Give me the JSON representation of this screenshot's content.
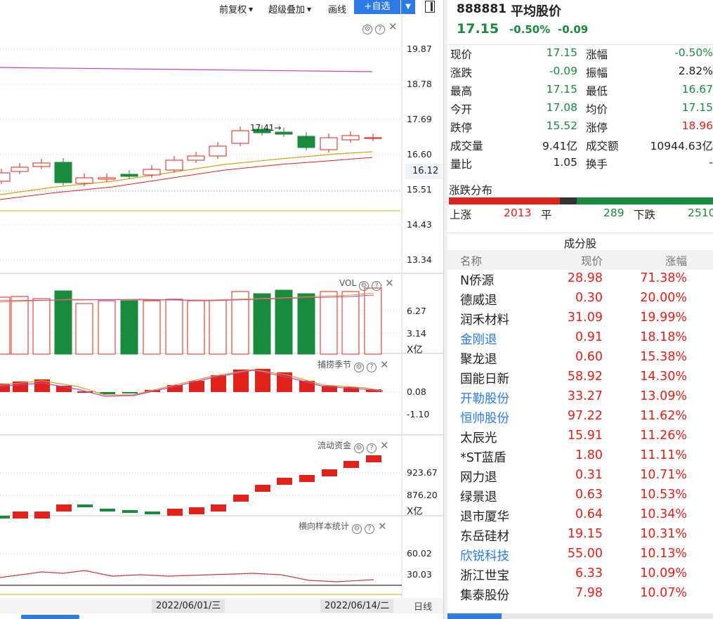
{
  "toolbar": {
    "rights_label": "前复权",
    "overlay_label": "超级叠加",
    "draw_label": "画线",
    "add_fav_label": "+自选",
    "dropdown_glyph": "▼"
  },
  "main_chart": {
    "y_ticks": [
      "19.87",
      "18.78",
      "17.69",
      "16.60",
      "15.51",
      "14.43",
      "13.34"
    ],
    "current_price": "16.12",
    "high_annotation": "17.41→",
    "colors": {
      "up": "#e0221b",
      "down": "#1a8a3c",
      "ma1": "#d4a017",
      "ma2": "#e0221b",
      "ma3": "#c040c0"
    }
  },
  "vol_pane": {
    "title": "VOL",
    "y_ticks": [
      "6.27",
      "3.14"
    ],
    "unit": "X亿"
  },
  "cycle_pane": {
    "title": "捕捞季节",
    "y_ticks": [
      "0.08",
      "-1.10"
    ]
  },
  "flow_pane": {
    "title": "流动资金",
    "y_ticks": [
      "923.67",
      "876.20"
    ],
    "unit": "X亿"
  },
  "stat_pane": {
    "title": "横向样本统计",
    "y_ticks": [
      "60.02",
      "30.03"
    ]
  },
  "datebar": {
    "date1": "2022/06/01/三",
    "date2": "2022/06/14/二",
    "period": "日线"
  },
  "quote": {
    "code": "888881",
    "name": "平均股价",
    "price": "17.15",
    "pct": "-0.50%",
    "change": "-0.09",
    "rows": [
      {
        "l1": "现价",
        "v1": "17.15",
        "c1": "green",
        "l2": "涨幅",
        "v2": "-0.50%",
        "c2": "green"
      },
      {
        "l1": "涨跌",
        "v1": "-0.09",
        "c1": "green",
        "l2": "振幅",
        "v2": "2.82%",
        "c2": "dark"
      },
      {
        "l1": "最高",
        "v1": "17.15",
        "c1": "green",
        "l2": "最低",
        "v2": "16.67",
        "c2": "green"
      },
      {
        "l1": "今开",
        "v1": "17.08",
        "c1": "green",
        "l2": "均价",
        "v2": "17.15",
        "c2": "green"
      },
      {
        "l1": "跌停",
        "v1": "15.52",
        "c1": "green",
        "l2": "涨停",
        "v2": "18.96",
        "c2": "red"
      },
      {
        "l1": "成交量",
        "v1": "9.41亿",
        "c1": "dark",
        "l2": "成交额",
        "v2": "10944.63亿",
        "c2": "dark"
      },
      {
        "l1": "量比",
        "v1": "1.05",
        "c1": "dark",
        "l2": "换手",
        "v2": "-",
        "c2": "dark"
      }
    ]
  },
  "distribution": {
    "title": "涨跌分布",
    "up_label": "上涨",
    "up_count": "2013",
    "flat_label": "平",
    "flat_count": "289",
    "down_label": "下跌",
    "down_count": "2510"
  },
  "constituents": {
    "title": "成分股",
    "headers": {
      "name": "名称",
      "price": "现价",
      "pct": "涨幅"
    },
    "rows": [
      {
        "name": "N侨源",
        "price": "28.98",
        "pct": "71.38%",
        "link": false
      },
      {
        "name": "德威退",
        "price": "0.30",
        "pct": "20.00%",
        "link": false
      },
      {
        "name": "润禾材料",
        "price": "31.09",
        "pct": "19.99%",
        "link": false
      },
      {
        "name": "金刚退",
        "price": "0.91",
        "pct": "18.18%",
        "link": true
      },
      {
        "name": "聚龙退",
        "price": "0.60",
        "pct": "15.38%",
        "link": false
      },
      {
        "name": "国能日新",
        "price": "58.92",
        "pct": "14.30%",
        "link": false
      },
      {
        "name": "开勒股份",
        "price": "33.27",
        "pct": "13.09%",
        "link": true
      },
      {
        "name": "恒帅股份",
        "price": "97.22",
        "pct": "11.62%",
        "link": true
      },
      {
        "name": "太辰光",
        "price": "15.91",
        "pct": "11.26%",
        "link": false
      },
      {
        "name": "*ST蓝盾",
        "price": "1.80",
        "pct": "11.11%",
        "link": false
      },
      {
        "name": "网力退",
        "price": "0.31",
        "pct": "10.71%",
        "link": false
      },
      {
        "name": "绿景退",
        "price": "0.63",
        "pct": "10.53%",
        "link": false
      },
      {
        "name": "退市厦华",
        "price": "0.64",
        "pct": "10.34%",
        "link": false
      },
      {
        "name": "东岳硅材",
        "price": "19.15",
        "pct": "10.31%",
        "link": false
      },
      {
        "name": "欣锐科技",
        "price": "55.00",
        "pct": "10.13%",
        "link": true
      },
      {
        "name": "浙江世宝",
        "price": "6.33",
        "pct": "10.09%",
        "link": false
      },
      {
        "name": "集泰股份",
        "price": "7.98",
        "pct": "10.07%",
        "link": false
      }
    ]
  }
}
